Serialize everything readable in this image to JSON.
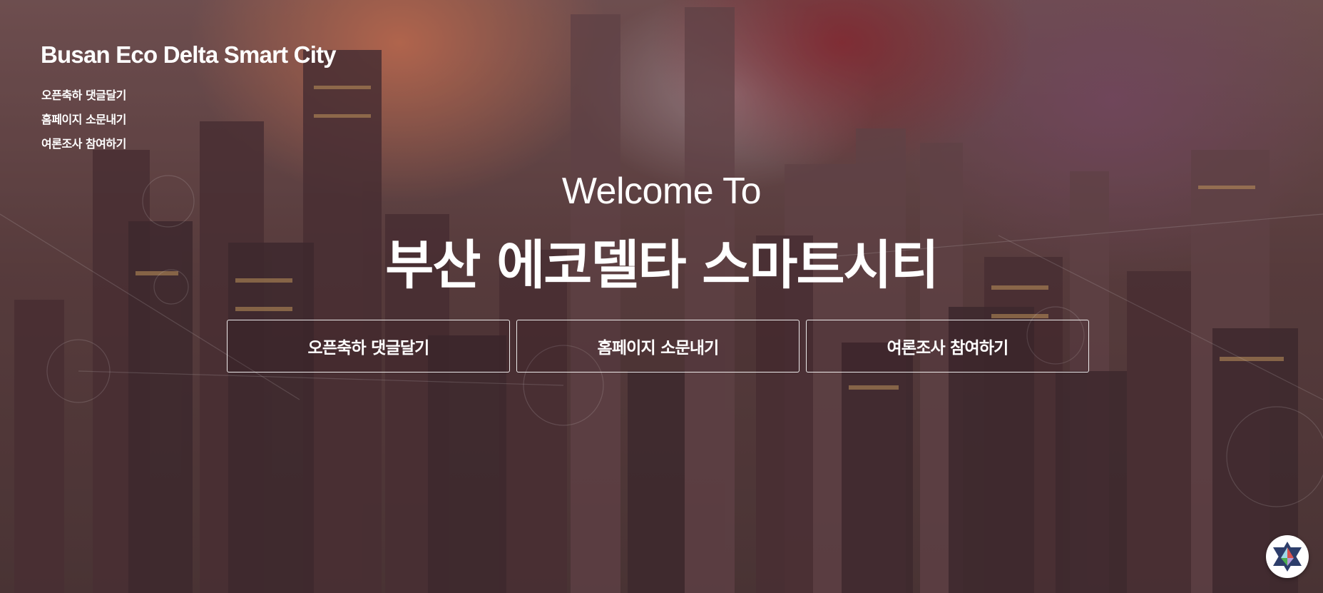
{
  "brand": {
    "title": "Busan Eco Delta Smart City"
  },
  "side_nav": {
    "items": [
      {
        "label": "오픈축하 댓글달기"
      },
      {
        "label": "홈페이지 소문내기"
      },
      {
        "label": "여론조사 참여하기"
      }
    ]
  },
  "hero": {
    "welcome": "Welcome To",
    "title": "부산 에코델타 스마트시티"
  },
  "actions": {
    "buttons": [
      {
        "label": "오픈축하 댓글달기"
      },
      {
        "label": "홈페이지 소문내기"
      },
      {
        "label": "여론조사 참여하기"
      }
    ]
  },
  "icons": {
    "badge": "hexagram-logo-icon",
    "background": "city-skyline-image"
  },
  "colors": {
    "text": "#ffffff",
    "button_border": "#ffffff",
    "badge_background": "#ffffff",
    "badge_accent": "#2d3e6b"
  }
}
